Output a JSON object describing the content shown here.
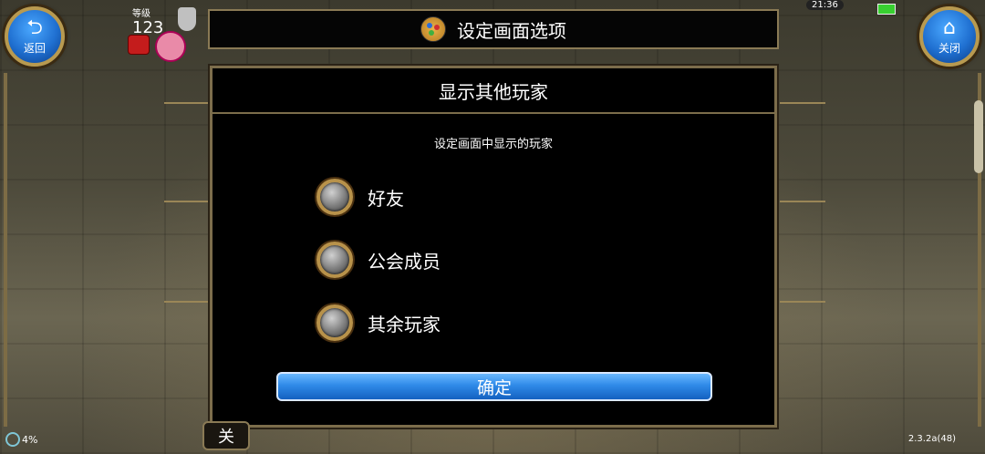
{
  "top_left": {
    "back_label": "返回",
    "level_label": "等级",
    "level_value": "123"
  },
  "top_right": {
    "close_label": "关闭",
    "time": "21:36"
  },
  "title_bar": {
    "title": "设定画面选项"
  },
  "dialog": {
    "header": "显示其他玩家",
    "subtitle": "设定画面中显示的玩家",
    "options": [
      {
        "label": "好友",
        "selected": false
      },
      {
        "label": "公会成员",
        "selected": false
      },
      {
        "label": "其余玩家",
        "selected": false
      }
    ],
    "confirm_label": "确定"
  },
  "bottom": {
    "tab_label": "关",
    "load_percent": "4%",
    "version": "2.3.2a(48)"
  },
  "colors": {
    "button_blue": "#2f8ae8",
    "frame_gold": "#b8924a",
    "dialog_bg": "#000000"
  }
}
